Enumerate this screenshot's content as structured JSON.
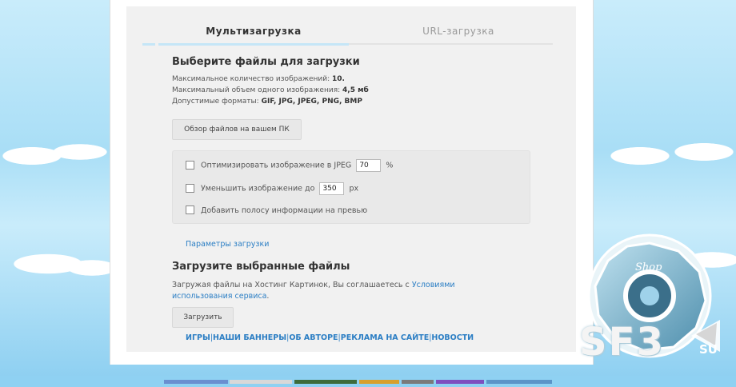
{
  "tabs": [
    {
      "label": "Мультизагрузка",
      "active": true
    },
    {
      "label": "URL-загрузка",
      "active": false
    }
  ],
  "select_section": {
    "heading": "Выберите файлы для загрузки",
    "max_count_label": "Максимальное количество изображений:",
    "max_count_value": "10.",
    "max_size_label": "Максимальный объем одного изображения:",
    "max_size_value": "4,5 мб",
    "formats_label": "Допустимые форматы:",
    "formats_value": "GIF, JPG, JPEG, PNG, BMP",
    "browse_button": "Обзор файлов на вашем ПК"
  },
  "options": {
    "optimize_label": "Оптимизировать изображение в JPEG",
    "optimize_value": "70",
    "optimize_unit": "%",
    "resize_label": "Уменьшить изображение до",
    "resize_value": "350",
    "resize_unit": "px",
    "infobar_label": "Добавить полосу информации на превью"
  },
  "params_link": "Параметры загрузки",
  "upload_section": {
    "heading": "Загрузите выбранные файлы",
    "agree_text": "Загружая файлы на Хостинг Картинок, Вы соглашаетесь с",
    "terms_link": "Условиями использования сервиса",
    "agree_end": ".",
    "upload_button": "Загрузить"
  },
  "footer_nav": [
    "ИГРЫ",
    "НАШИ БАННЕРЫ",
    "ОБ АВТОРЕ",
    "РЕКЛАМА НА САЙТЕ",
    "НОВОСТИ"
  ],
  "footer_separator": "|",
  "watermark": {
    "badge_text": "Shop",
    "site_text": "SF3",
    "site_suffix": "SU"
  },
  "colors": {
    "accent_link": "#2b7ec4",
    "tab_underline": "#c5e6f7",
    "badge_blue": "#5a9bb8"
  }
}
